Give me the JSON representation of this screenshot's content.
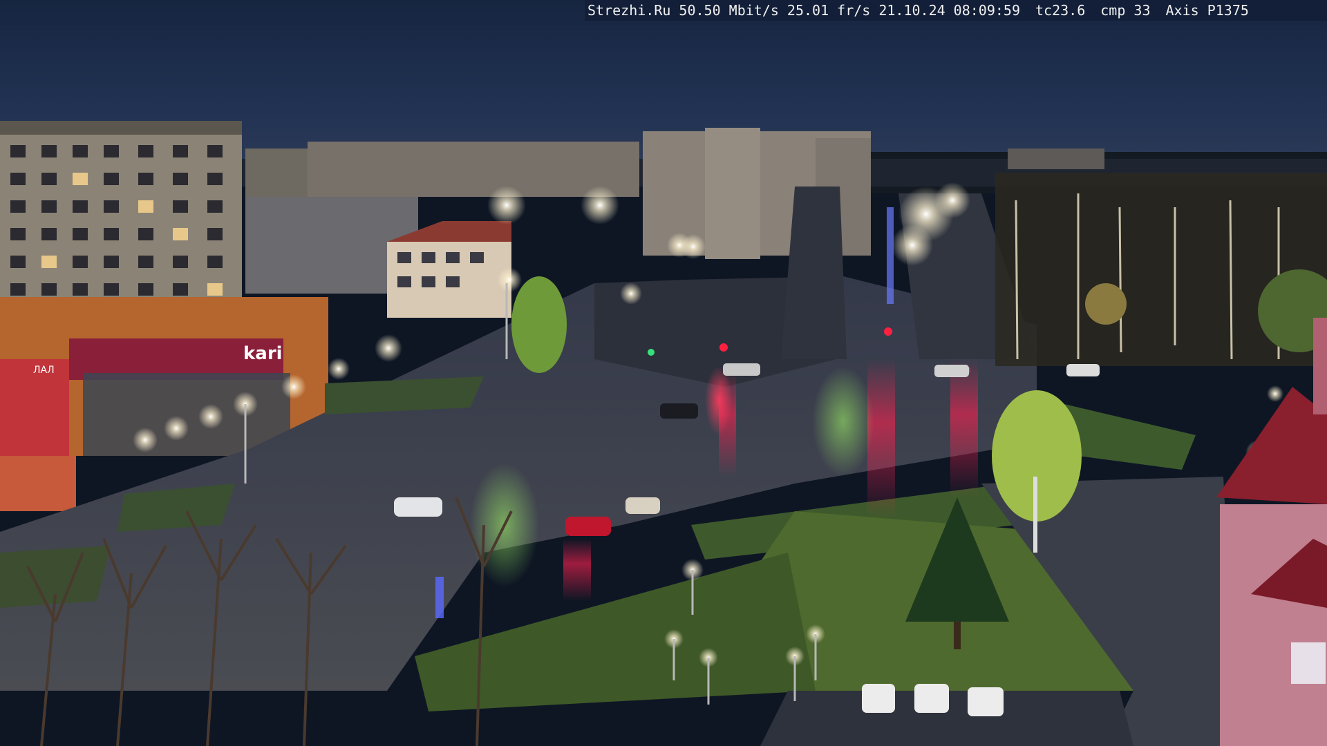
{
  "overlay": {
    "site": "Strezhi.Ru",
    "bitrate": "50.50 Mbit/s",
    "framerate": "25.01 fr/s",
    "date": "21.10.24",
    "time": "08:09:59",
    "tc": "tc23.6",
    "cmp": "cmp 33",
    "camera": "Axis P1375"
  },
  "signage": {
    "store_name": "kari",
    "store_left": "ЛАЛ"
  },
  "colors": {
    "sky": "#1b2a47",
    "road": "#3b3f4a",
    "grass": "#3f5a2a",
    "street_light": "#fff6e0"
  }
}
